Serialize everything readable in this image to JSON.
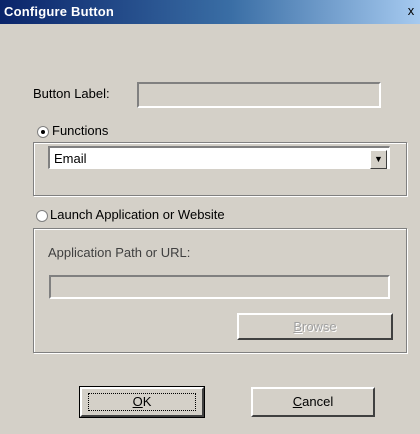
{
  "window": {
    "title": "Configure Button",
    "close_glyph": "x"
  },
  "button_label": {
    "label": "Button Label:",
    "value": ""
  },
  "functions": {
    "radio_label": "Functions",
    "selected": true,
    "dropdown_value": "Email"
  },
  "launch": {
    "radio_label": "Launch Application or Website",
    "selected": false,
    "path_label": "Application Path or URL:",
    "path_value": ""
  },
  "buttons": {
    "browse": {
      "accel": "B",
      "rest": "rowse"
    },
    "ok": {
      "accel": "O",
      "rest": "K"
    },
    "cancel": {
      "accel": "C",
      "rest": "ancel"
    }
  },
  "icons": [
    "close-icon",
    "dropdown-arrow-icon"
  ],
  "colors": {
    "title_start": "#0a246a",
    "title_end": "#a6caf0",
    "face": "#d4d0c8"
  }
}
